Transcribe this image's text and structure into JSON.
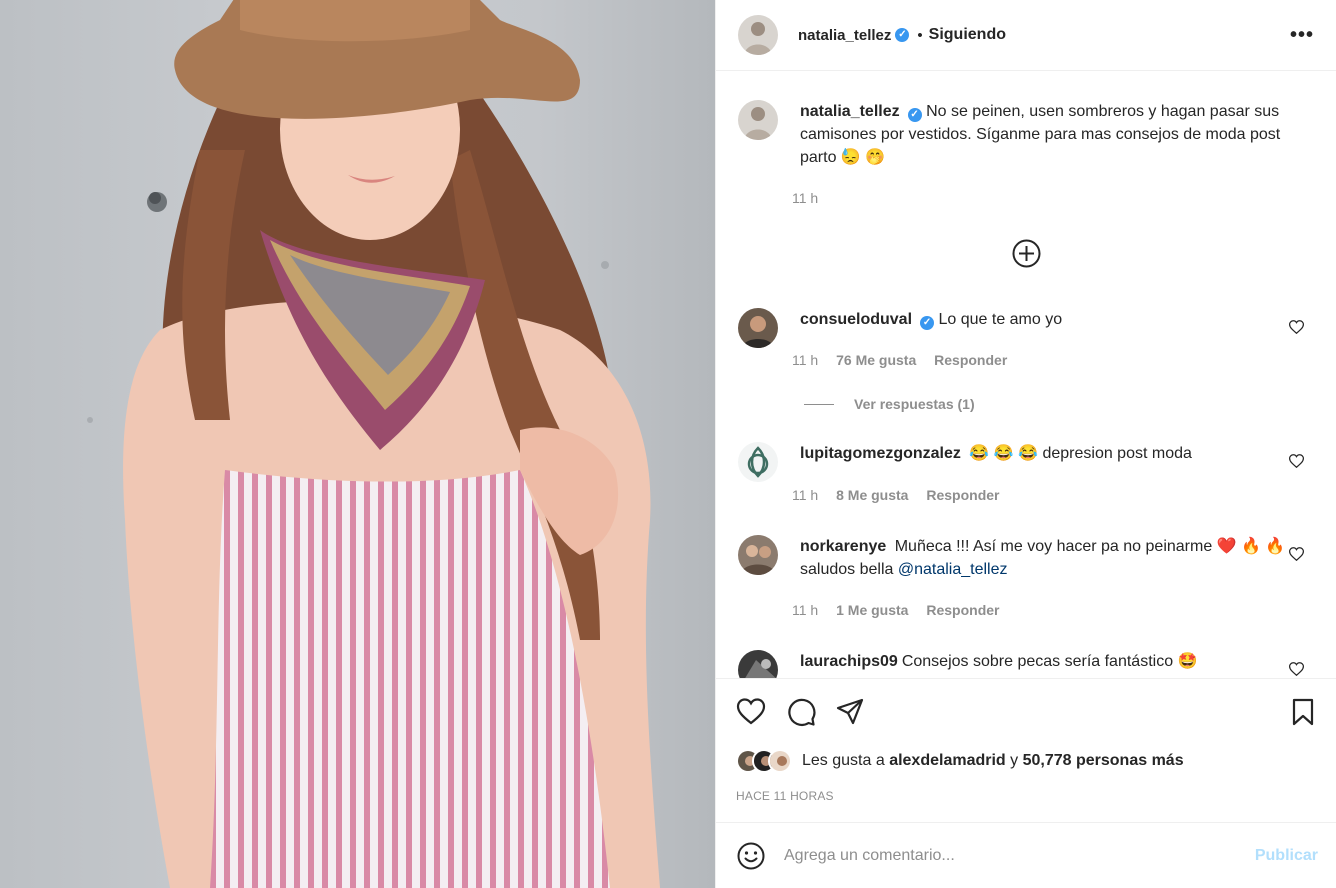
{
  "post": {
    "author": "natalia_tellez",
    "follow_status": "Siguiendo",
    "dot": "•",
    "more": "•••",
    "caption": "No se peinen, usen sombreros y hagan pasar sus camisones por vestidos. Síganme para mas consejos de moda post parto 😓 🤭",
    "caption_time": "11 h"
  },
  "comments": [
    {
      "user": "consueloduval",
      "verified": true,
      "text": "Lo que te amo yo",
      "time": "11 h",
      "likes": "76 Me gusta",
      "reply": "Responder"
    },
    {
      "user": "lupitagomezgonzalez",
      "verified": false,
      "text": "😂 😂 😂 depresion post moda",
      "time": "11 h",
      "likes": "8 Me gusta",
      "reply": "Responder"
    },
    {
      "user": "norkarenye",
      "verified": false,
      "text": "Muñeca !!! Así me voy hacer pa no peinarme ❤️ 🔥 🔥 saludos bella",
      "mention": "@natalia_tellez",
      "time": "11 h",
      "likes": "1 Me gusta",
      "reply": "Responder"
    },
    {
      "user": "laurachips09",
      "verified": false,
      "text": "Consejos sobre pecas sería fantástico 🤩"
    }
  ],
  "view_replies": "Ver respuestas (1)",
  "likes_summary": {
    "prefix": "Les gusta a",
    "user": "alexdelamadrid",
    "joiner": "y",
    "others": "50,778 personas más"
  },
  "posted_ago": "HACE 11 HORAS",
  "composer": {
    "placeholder": "Agrega un comentario...",
    "publish": "Publicar"
  },
  "icons": [
    "heart-icon",
    "comment-icon",
    "share-icon",
    "bookmark-icon",
    "add-circle-icon",
    "emoji-icon",
    "verified-badge-icon"
  ],
  "colors": {
    "verified": "#3897f0",
    "link": "#00376b",
    "publish_disabled": "#b2dffc",
    "muted": "#8e8e8e"
  }
}
